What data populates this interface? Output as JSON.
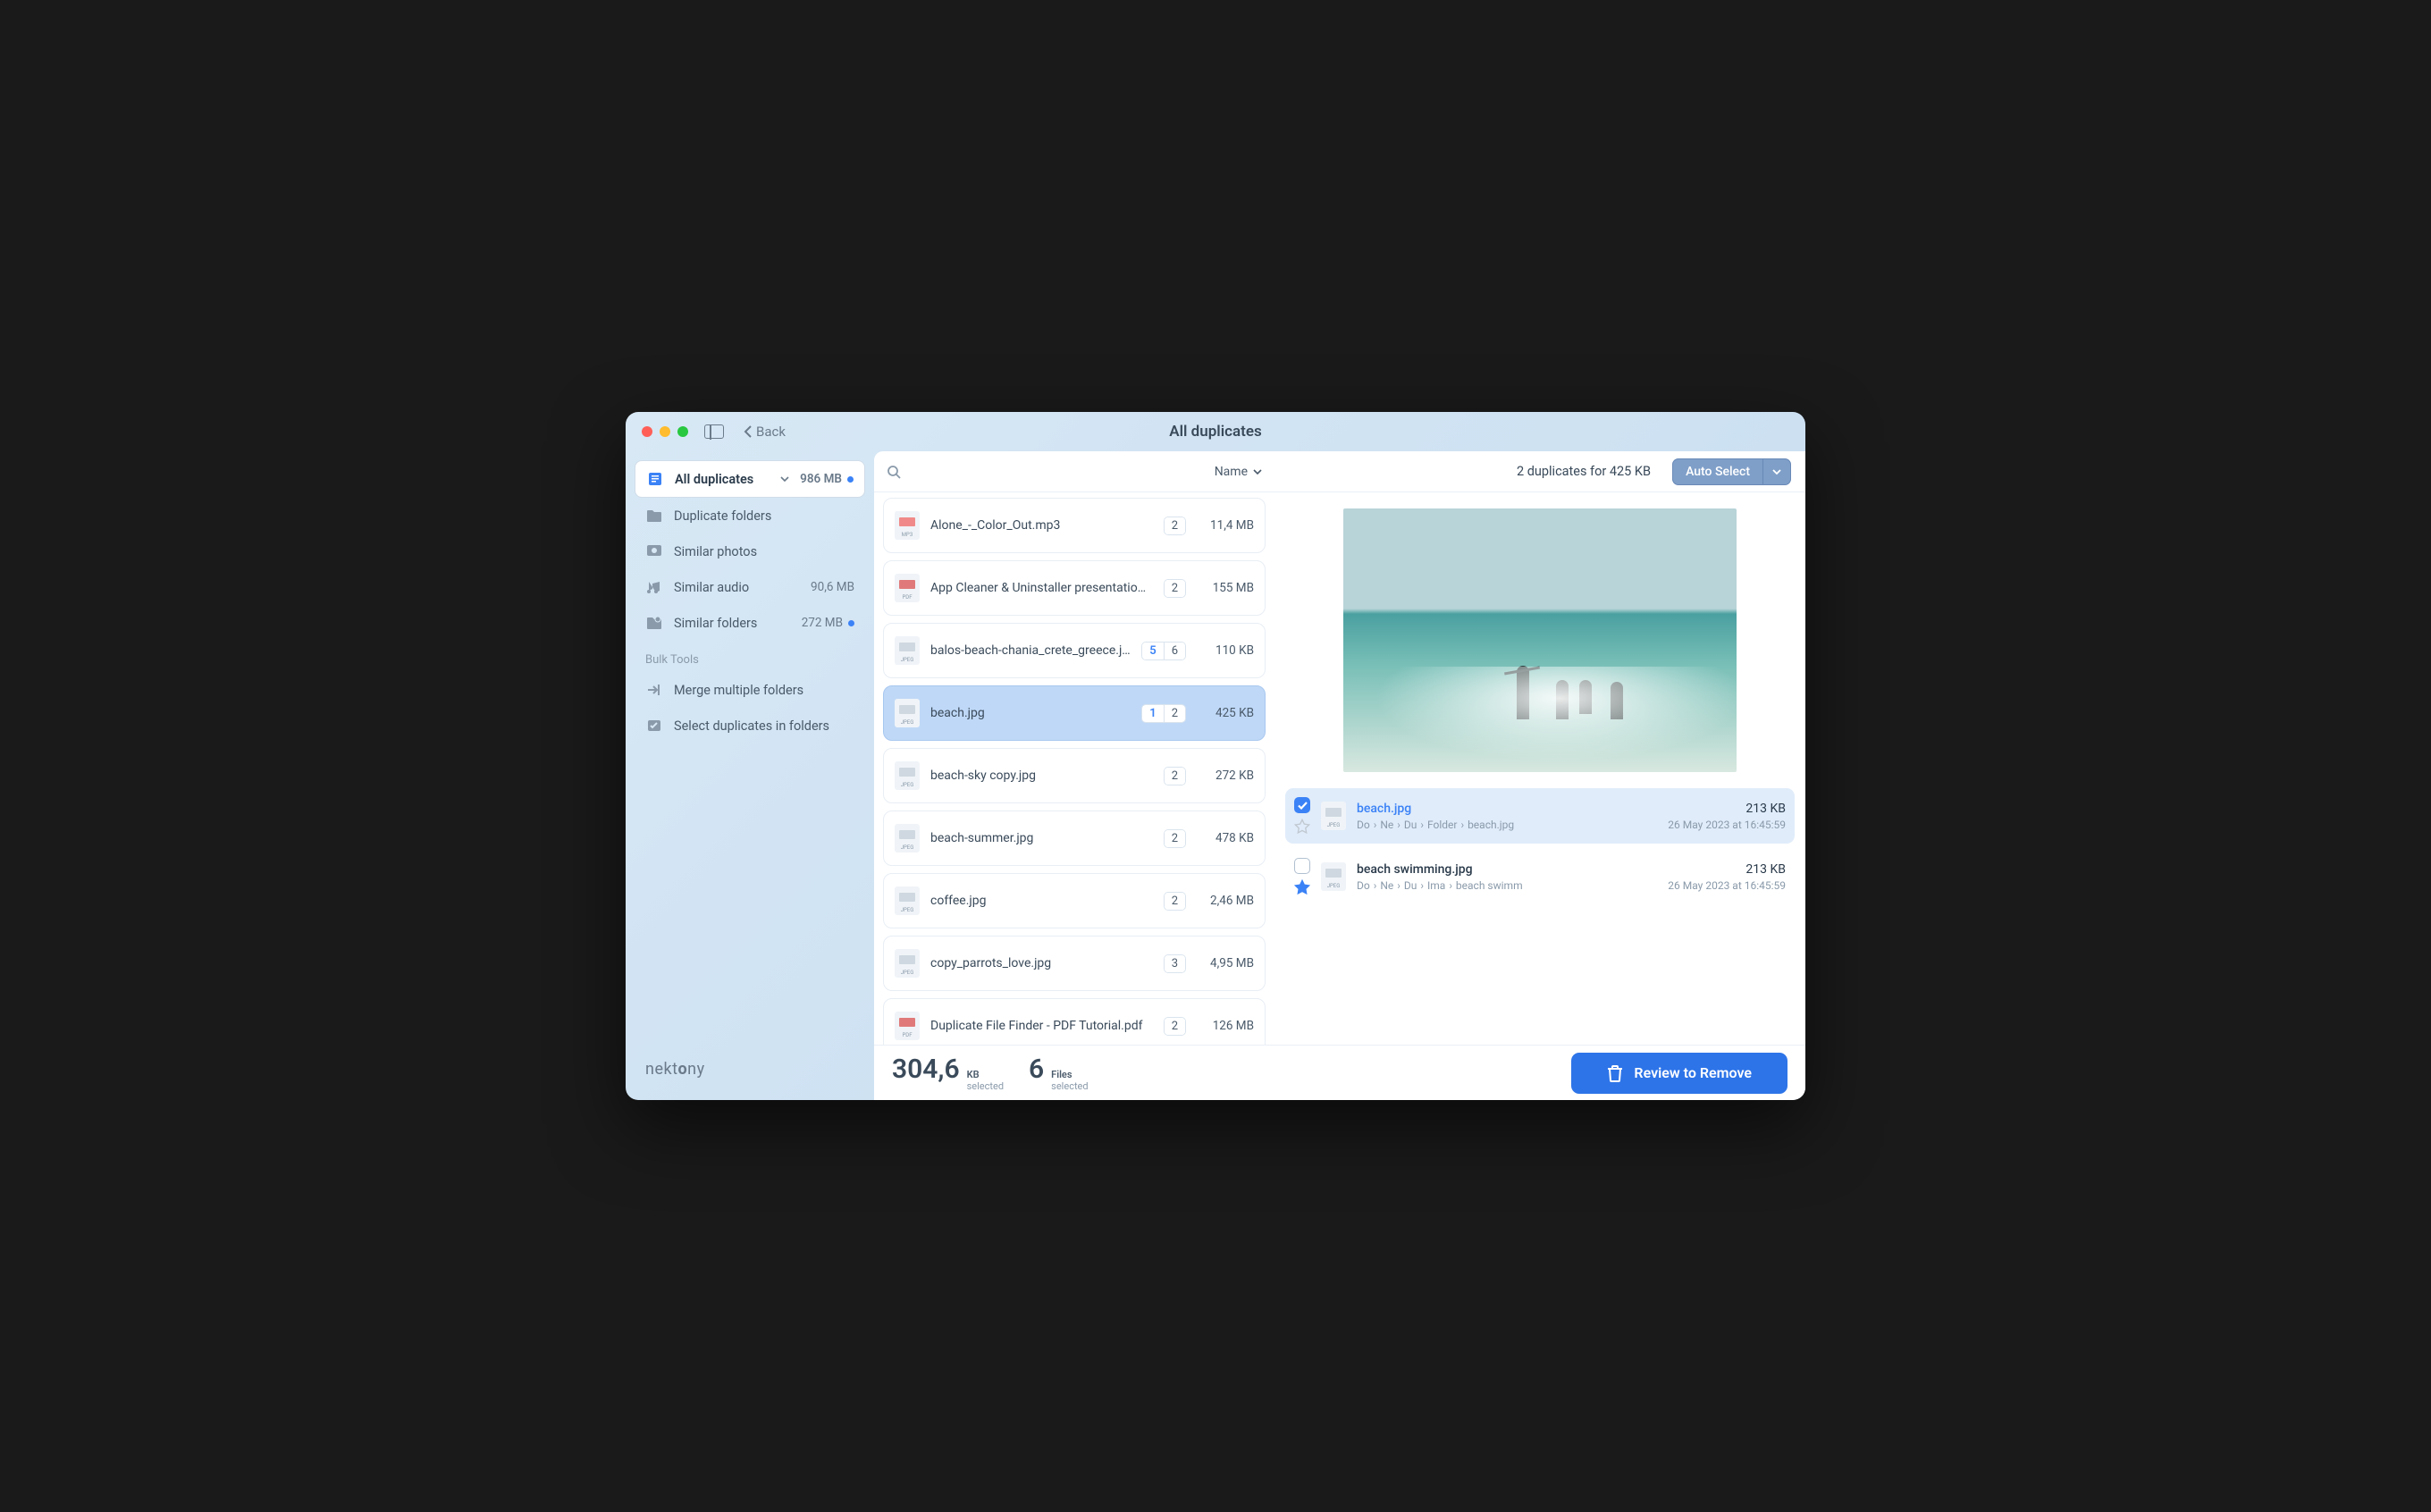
{
  "window": {
    "title": "All duplicates",
    "back_label": "Back"
  },
  "sidebar": {
    "items": [
      {
        "label": "All duplicates",
        "meta": "986 MB",
        "dot": true,
        "active": true
      },
      {
        "label": "Duplicate folders"
      },
      {
        "label": "Similar photos"
      },
      {
        "label": "Similar audio",
        "meta": "90,6 MB"
      },
      {
        "label": "Similar folders",
        "meta": "272 MB",
        "dot": true
      }
    ],
    "section_label": "Bulk Tools",
    "tools": [
      {
        "label": "Merge multiple folders"
      },
      {
        "label": "Select duplicates in folders"
      }
    ],
    "brand": "nektony"
  },
  "list": {
    "sort_label": "Name",
    "rows": [
      {
        "name": "Alone_-_Color_Out.mp3",
        "badges": [
          "2"
        ],
        "size": "11,4 MB",
        "type": "MP3"
      },
      {
        "name": "App Cleaner & Uninstaller presentation…",
        "badges": [
          "2"
        ],
        "size": "155 MB",
        "type": "PDF"
      },
      {
        "name": "balos-beach-chania_crete_greece.j…",
        "badges": [
          "5",
          "6"
        ],
        "badge_blue": 0,
        "size": "110 KB",
        "type": "JPEG"
      },
      {
        "name": "beach.jpg",
        "badges": [
          "1",
          "2"
        ],
        "badge_blue": 0,
        "size": "425 KB",
        "type": "JPEG",
        "selected": true
      },
      {
        "name": "beach-sky copy.jpg",
        "badges": [
          "2"
        ],
        "size": "272 KB",
        "type": "JPEG"
      },
      {
        "name": "beach-summer.jpg",
        "badges": [
          "2"
        ],
        "size": "478 KB",
        "type": "JPEG"
      },
      {
        "name": "coffee.jpg",
        "badges": [
          "2"
        ],
        "size": "2,46 MB",
        "type": "JPEG"
      },
      {
        "name": "copy_parrots_love.jpg",
        "badges": [
          "3"
        ],
        "size": "4,95 MB",
        "type": "JPEG"
      },
      {
        "name": "Duplicate File Finder -  PDF Tutorial.pdf",
        "badges": [
          "2"
        ],
        "size": "126 MB",
        "type": "PDF"
      }
    ]
  },
  "detail": {
    "summary": "2 duplicates for 425 KB",
    "auto_select_label": "Auto Select",
    "duplicates": [
      {
        "checked": true,
        "star": false,
        "filename": "beach.jpg",
        "filename_blue": true,
        "crumbs": [
          "Do",
          "Ne",
          "Du",
          "Folder",
          "beach.jpg"
        ],
        "size": "213 KB",
        "date": "26 May 2023 at 16:45:59"
      },
      {
        "checked": false,
        "star": true,
        "filename": "beach swimming.jpg",
        "filename_blue": false,
        "crumbs": [
          "Do",
          "Ne",
          "Du",
          "Ima",
          "beach swimm"
        ],
        "size": "213 KB",
        "date": "26 May 2023 at 16:45:59"
      }
    ]
  },
  "footer": {
    "size_num": "304,6",
    "size_unit": "KB",
    "size_sub": "selected",
    "files_num": "6",
    "files_unit": "Files",
    "files_sub": "selected",
    "review_label": "Review to Remove"
  }
}
